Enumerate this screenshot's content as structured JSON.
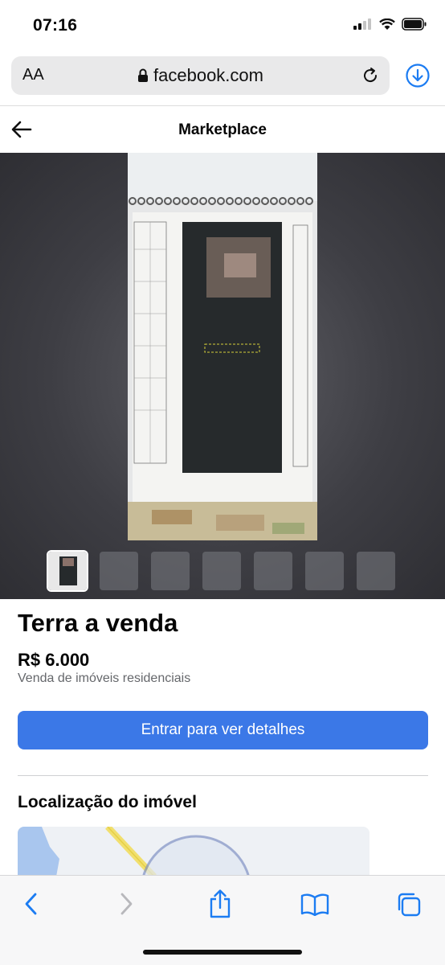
{
  "status": {
    "time": "07:16"
  },
  "browser": {
    "aa_label": "AA",
    "url": "facebook.com"
  },
  "header": {
    "title": "Marketplace"
  },
  "listing": {
    "title": "Terra a venda",
    "price": "R$ 6.000",
    "category": "Venda de imóveis residenciais",
    "cta_label": "Entrar para ver detalhes"
  },
  "location": {
    "title": "Localização do imóvel"
  },
  "gallery": {
    "thumbnail_count": 7,
    "active_index": 0
  },
  "colors": {
    "accent": "#3b78e7",
    "ios_blue": "#1c7cf2"
  },
  "icons": [
    "signal-icon",
    "wifi-icon",
    "battery-icon",
    "lock-icon",
    "reload-icon",
    "download-icon",
    "back-arrow-icon",
    "nav-back-icon",
    "nav-forward-icon",
    "share-icon",
    "bookmarks-icon",
    "tabs-icon"
  ]
}
